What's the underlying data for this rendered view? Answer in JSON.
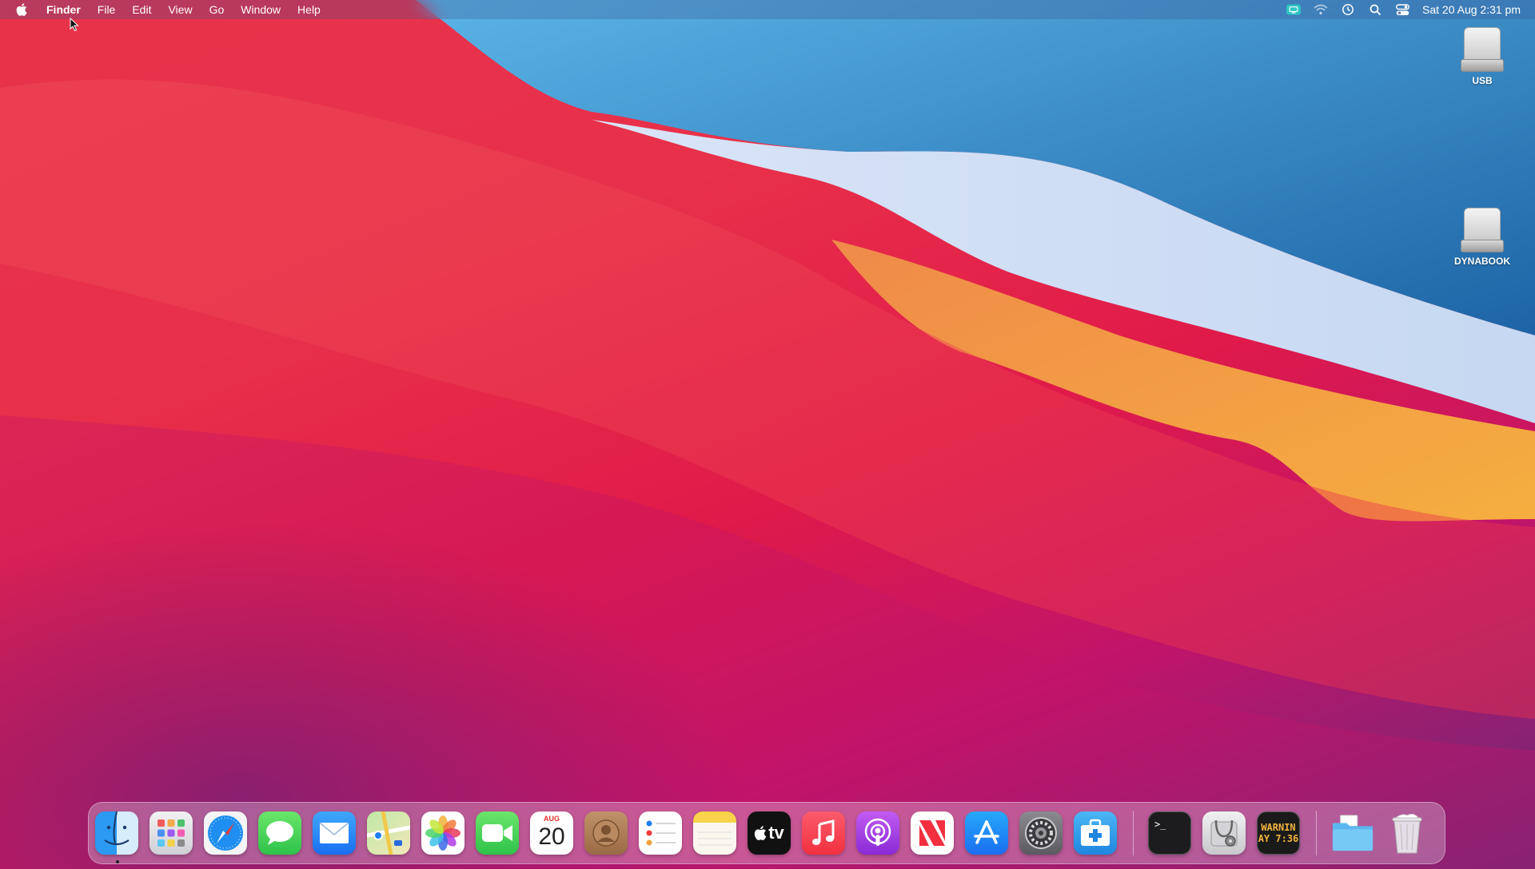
{
  "menubar": {
    "app_name": "Finder",
    "menus": [
      "File",
      "Edit",
      "View",
      "Go",
      "Window",
      "Help"
    ],
    "clock": "Sat 20 Aug  2:31 pm",
    "status_icons": [
      "screen-sharing-icon",
      "wifi-icon",
      "time-machine-icon",
      "spotlight-search-icon",
      "control-center-icon"
    ]
  },
  "desktop_icons": [
    {
      "label": "USB",
      "icon": "external-drive-icon"
    },
    {
      "label": "DYNABOOK",
      "icon": "external-drive-icon"
    }
  ],
  "dock": {
    "apps": [
      {
        "name": "finder",
        "icon": "finder-icon"
      },
      {
        "name": "launchpad",
        "icon": "launchpad-icon"
      },
      {
        "name": "safari",
        "icon": "safari-icon"
      },
      {
        "name": "messages",
        "icon": "messages-icon"
      },
      {
        "name": "mail",
        "icon": "mail-icon"
      },
      {
        "name": "maps",
        "icon": "maps-icon"
      },
      {
        "name": "photos",
        "icon": "photos-icon"
      },
      {
        "name": "facetime",
        "icon": "facetime-icon"
      },
      {
        "name": "calendar",
        "icon": "calendar-icon"
      },
      {
        "name": "contacts",
        "icon": "contacts-icon"
      },
      {
        "name": "reminders",
        "icon": "reminders-icon"
      },
      {
        "name": "notes",
        "icon": "notes-icon"
      },
      {
        "name": "apple-tv",
        "icon": "apple-tv-icon"
      },
      {
        "name": "music",
        "icon": "music-icon"
      },
      {
        "name": "podcasts",
        "icon": "podcasts-icon"
      },
      {
        "name": "news",
        "icon": "news-icon"
      },
      {
        "name": "app-store",
        "icon": "app-store-icon"
      },
      {
        "name": "system-preferences",
        "icon": "gear-icon"
      },
      {
        "name": "migration-assistant",
        "icon": "migration-assistant-icon"
      },
      {
        "name": "terminal",
        "icon": "terminal-icon"
      },
      {
        "name": "disk-utility",
        "icon": "disk-utility-icon"
      },
      {
        "name": "console",
        "icon": "console-icon"
      },
      {
        "name": "downloads",
        "icon": "folder-icon"
      },
      {
        "name": "trash",
        "icon": "trash-icon"
      }
    ],
    "calendar": {
      "month": "AUG",
      "day": "20"
    },
    "tv_label": "tv",
    "terminal_prompt": ">_",
    "console_text": [
      "WARNIN",
      "AY 7:36"
    ]
  },
  "colors": {
    "wallpaper_red": "#e8304a",
    "wallpaper_blue": "#2f7fc0",
    "wallpaper_orange": "#f29a3a",
    "accent_blue": "#1a7cf5"
  }
}
